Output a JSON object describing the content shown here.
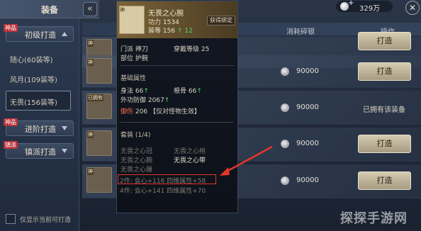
{
  "header": {
    "title": "装备",
    "back_icon": "back-icon"
  },
  "currency": {
    "plus": "+",
    "value": "329万"
  },
  "close_label": "✕",
  "left": {
    "categories": [
      {
        "tag": "神品",
        "label": "初级打造"
      },
      {
        "tag": "神品",
        "label": "进阶打造"
      },
      {
        "tag": "镇派",
        "label": "镇派打造"
      }
    ],
    "sub_items": [
      "随心(60装等)",
      "风月(109装等)",
      "无畏(156装等)"
    ],
    "only_label": "仅显示当前可打造"
  },
  "list": {
    "header_cost": "消耗碎银",
    "header_op": "操作",
    "rows": [
      {
        "badge": "神",
        "cost": "",
        "action": "打造",
        "owned": ""
      },
      {
        "badge": "神",
        "cost": "90000",
        "action": "打造",
        "owned": ""
      },
      {
        "badge": "已拥有",
        "cost": "90000",
        "action": "",
        "owned": "已拥有该装备"
      },
      {
        "badge": "神",
        "cost": "90000",
        "action": "打造",
        "owned": ""
      },
      {
        "badge": "神",
        "cost": "90000",
        "action": "打造",
        "owned": ""
      }
    ]
  },
  "popup": {
    "icon_tag": "神",
    "name": "无畏之心腕",
    "power_label": "功力",
    "power_value": "1534",
    "level_label": "装等",
    "level_value": "156",
    "level_up": "↑ 12",
    "bound_label": "获得绑定",
    "sect_label": "门派",
    "sect_value": "神刀",
    "wear_label": "穿戴等级",
    "wear_value": "25",
    "part_label": "部位",
    "part_value": "护腕",
    "base_title": "基础属性",
    "attr1_label": "身法",
    "attr1_value": "66",
    "attr1_up": "↑",
    "attr2_label": "根骨",
    "attr2_value": "66",
    "attr2_up": "↑",
    "attr3_label": "外功防御",
    "attr3_value": "2067",
    "attr3_up": "↑",
    "special_tag": "御伤",
    "special_value": "206",
    "special_note": "【仅对怪物生效】",
    "set_title": "套装",
    "set_count": "(1/4)",
    "set_items": [
      "无畏之心冠",
      "无畏之心袍",
      "无畏之心腕",
      "无畏之心带",
      "无畏之心履"
    ],
    "set_bonus1": "2件: 会心+116 四维属性+58",
    "set_bonus2": "4件: 会心+141 四维属性+70"
  },
  "watermark": "探探手游网",
  "colors": {
    "highlight": "#e5352a",
    "green": "#5ad46a",
    "accent_gold": "#7a6338"
  }
}
